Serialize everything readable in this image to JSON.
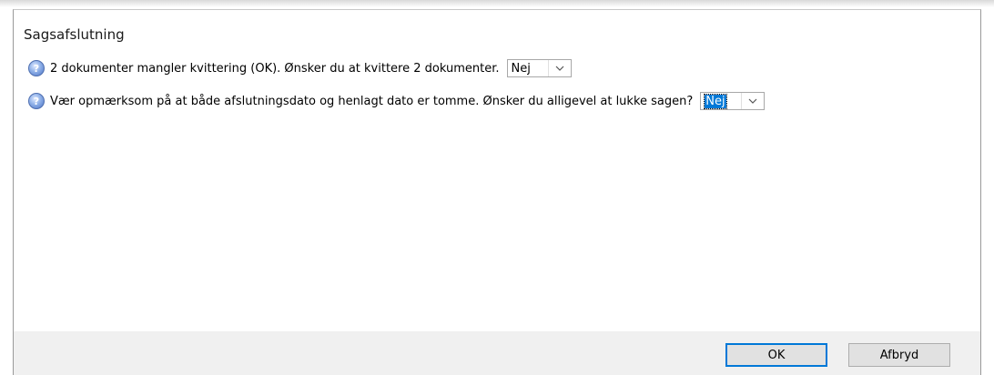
{
  "dialog": {
    "title": "Sagsafslutning"
  },
  "questions": [
    {
      "icon": "question-mark-icon",
      "text": "2 dokumenter mangler kvittering (OK). Ønsker du at kvittere 2 dokumenter.",
      "answer": "Nej",
      "selected": false
    },
    {
      "icon": "question-mark-icon",
      "text": "Vær opmærksom på at både afslutningsdato og henlagt dato er tomme. Ønsker du alligevel at lukke sagen?",
      "answer": "Nej",
      "selected": true
    }
  ],
  "buttons": {
    "ok_label": "OK",
    "cancel_label": "Afbryd"
  },
  "colors": {
    "accent": "#0078d7",
    "footer_bg": "#f0f0f0"
  }
}
